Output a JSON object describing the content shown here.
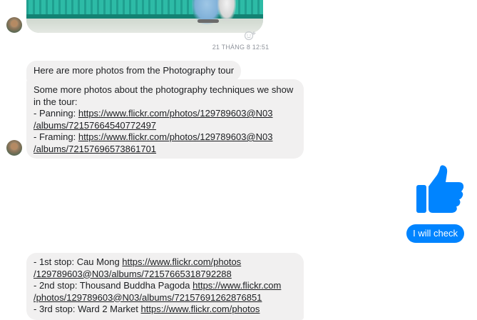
{
  "thread": {
    "timestamp": "21 THÁNG 8 12:51",
    "messages": [
      {
        "from": "contact",
        "text": "Here are more photos from the Photography tour"
      },
      {
        "from": "contact",
        "lines": [
          {
            "text": "Some more photos about the photography techniques we show"
          },
          {
            "text": "in the tour:"
          },
          {
            "prefix": "- Panning: ",
            "link": "https://www.flickr.com/photos/129789603@N03"
          },
          {
            "link": "/albums/72157664540772497"
          },
          {
            "prefix": "- Framing: ",
            "link": "https://www.flickr.com/photos/129789603@N03"
          },
          {
            "link": "/albums/72157696573861701"
          }
        ]
      },
      {
        "from": "me",
        "type": "like",
        "icon": "thumbs-up-icon"
      },
      {
        "from": "me",
        "text": "I will check"
      },
      {
        "from": "contact",
        "lines": [
          {
            "prefix": "- 1st stop: Cau Mong ",
            "link": "https://www.flickr.com/photos"
          },
          {
            "link": "/129789603@N03/albums/72157665318792288"
          },
          {
            "prefix": "- 2nd stop: Thousand Buddha Pagoda ",
            "link": "https://www.flickr.com"
          },
          {
            "link": "/photos/129789603@N03/albums/72157691262876851"
          },
          {
            "prefix": "- 3rd stop: Ward 2 Market ",
            "link": "https://www.flickr.com/photos"
          }
        ]
      }
    ]
  },
  "colors": {
    "incoming_bubble": "#f1f0f0",
    "outgoing_bubble": "#0084ff",
    "like": "#0084ff",
    "timestamp": "#90949c"
  },
  "icons": {
    "reaction": "add-reaction-icon",
    "avatar": "contact-avatar"
  }
}
